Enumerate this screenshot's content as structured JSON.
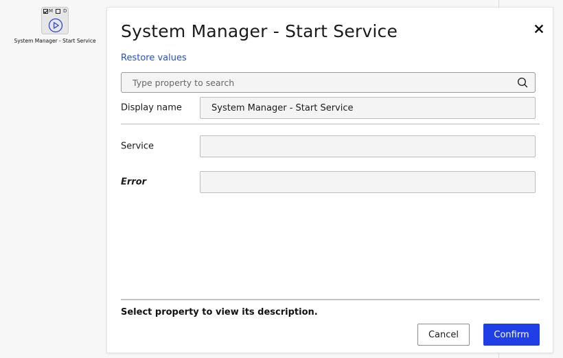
{
  "node": {
    "flag_m": "M",
    "flag_d": "D",
    "flag_m_checked": true,
    "flag_d_checked": false,
    "label": "System Manager - Start Service",
    "icon": "play-circle-icon"
  },
  "dialog": {
    "title": "System Manager - Start Service",
    "restore_label": "Restore values",
    "search": {
      "placeholder": "Type property to search",
      "value": ""
    },
    "display_name": {
      "label": "Display name",
      "value": "System Manager - Start Service"
    },
    "properties": [
      {
        "label": "Service",
        "value": ""
      },
      {
        "label": "Error",
        "value": ""
      }
    ],
    "description": "Select property to view its description.",
    "cancel_label": "Cancel",
    "confirm_label": "Confirm"
  },
  "colors": {
    "accent": "#1f3ee6",
    "link": "#2250c8",
    "icon_blue": "#2b45d6"
  }
}
